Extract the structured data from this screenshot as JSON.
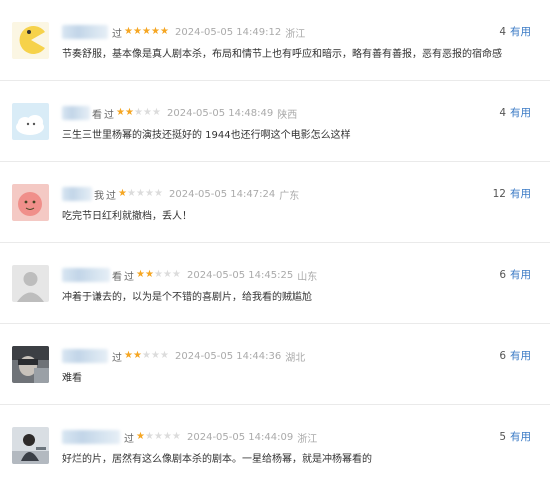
{
  "reviews": [
    {
      "user_tail": "",
      "watched": "过",
      "rating": 5,
      "time": "2024-05-05 14:49:12",
      "location": "浙江",
      "content": "节奏舒服，基本像是真人剧本杀，布局和情节上也有呼应和暗示，略有善有善报，恶有恶报的宿命感",
      "count": "4",
      "useful_label": "有用",
      "avatar": "pacman-avatar"
    },
    {
      "user_tail": "看",
      "watched": "过",
      "rating": 2,
      "time": "2024-05-05 14:48:49",
      "location": "陕西",
      "content": "三生三世里杨幂的演技还挺好的 1944也还行啊这个电影怎么这样",
      "count": "4",
      "useful_label": "有用",
      "avatar": "cloud-bunny-avatar"
    },
    {
      "user_tail": "我",
      "watched": "过",
      "rating": 1,
      "time": "2024-05-05 14:47:24",
      "location": "广东",
      "content": "吃完节日红利就撤档，丢人！",
      "count": "12",
      "useful_label": "有用",
      "avatar": "pink-cartoon-avatar"
    },
    {
      "user_tail": "看",
      "watched": "过",
      "rating": 2,
      "time": "2024-05-05 14:45:25",
      "location": "山东",
      "content": "冲着于谦去的，以为是个不错的喜剧片，给我看的贼尴尬",
      "count": "6",
      "useful_label": "有用",
      "avatar": "default-user-avatar"
    },
    {
      "user_tail": "",
      "watched": "过",
      "rating": 2,
      "time": "2024-05-05 14:44:36",
      "location": "湖北",
      "content": "难看",
      "count": "6",
      "useful_label": "有用",
      "avatar": "photo-avatar"
    },
    {
      "user_tail": "",
      "watched": "过",
      "rating": 1,
      "time": "2024-05-05 14:44:09",
      "location": "浙江",
      "content": "好烂的片，居然有这么像剧本杀的剧本。一星给杨幂，就是冲杨幂看的",
      "count": "5",
      "useful_label": "有用",
      "avatar": "person-photo-avatar"
    }
  ],
  "colors": {
    "star_on": "#f5a623",
    "star_off": "#dcdcdc",
    "link": "#3a7ac5",
    "muted": "#aaaaaa"
  }
}
